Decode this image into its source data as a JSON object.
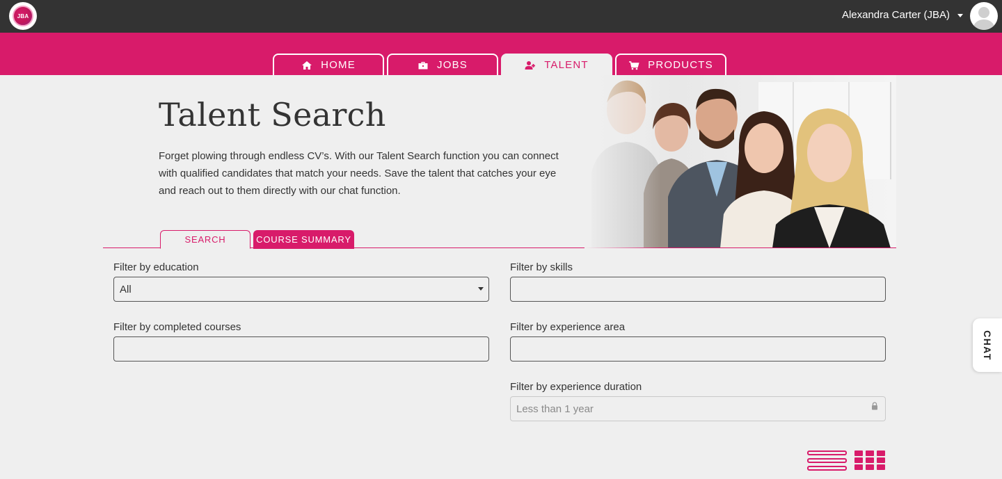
{
  "header": {
    "logo_text": "JBA",
    "user_name": "Alexandra Carter (JBA)"
  },
  "nav": {
    "tabs": [
      {
        "label": "HOME",
        "icon": "home-icon"
      },
      {
        "label": "JOBS",
        "icon": "briefcase-icon"
      },
      {
        "label": "TALENT",
        "icon": "user-plus-icon",
        "active": true
      },
      {
        "label": "PRODUCTS",
        "icon": "cart-icon"
      }
    ]
  },
  "hero": {
    "title": "Talent Search",
    "description": "Forget plowing through endless CV’s. With our Talent Search function you can connect with qualified candidates that match your needs. Save the talent that catches your eye and reach out to them directly with our chat function."
  },
  "search_tabs": {
    "search": "SEARCH",
    "course_summary": "COURSE SUMMARY"
  },
  "filters": {
    "education": {
      "label": "Filter by education",
      "value": "All"
    },
    "skills": {
      "label": "Filter by skills",
      "value": ""
    },
    "completed_courses": {
      "label": "Filter by completed courses",
      "value": ""
    },
    "experience_area": {
      "label": "Filter by experience area",
      "value": ""
    },
    "experience_duration": {
      "label": "Filter by experience duration",
      "placeholder": "Less than 1 year"
    }
  },
  "chat": {
    "label": "CHAT"
  },
  "colors": {
    "accent": "#d81b6a",
    "topbar": "#333333",
    "background": "#efefef"
  }
}
